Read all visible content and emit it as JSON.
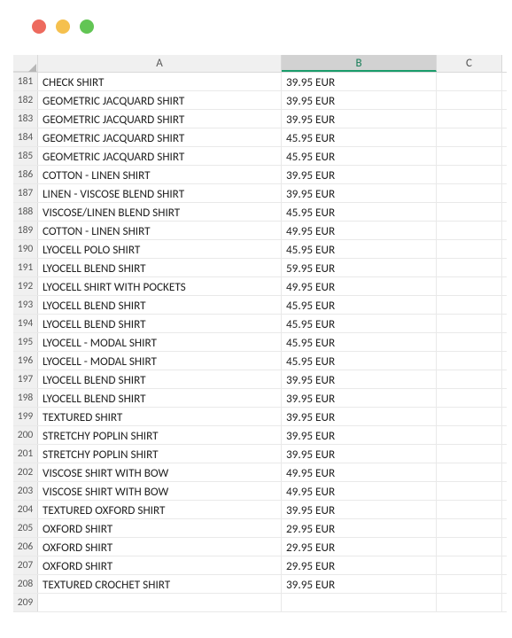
{
  "window": {
    "controls": [
      "close",
      "minimize",
      "maximize"
    ]
  },
  "spreadsheet": {
    "columns": [
      {
        "label": "A",
        "selected": false
      },
      {
        "label": "B",
        "selected": true
      },
      {
        "label": "C",
        "selected": false
      }
    ],
    "first_row_number": 181,
    "rows": [
      {
        "n": 181,
        "a": "CHECK SHIRT",
        "b": "39.95 EUR"
      },
      {
        "n": 182,
        "a": "GEOMETRIC JACQUARD SHIRT",
        "b": "39.95 EUR"
      },
      {
        "n": 183,
        "a": "GEOMETRIC JACQUARD SHIRT",
        "b": "39.95 EUR"
      },
      {
        "n": 184,
        "a": "GEOMETRIC JACQUARD SHIRT",
        "b": "45.95 EUR"
      },
      {
        "n": 185,
        "a": "GEOMETRIC JACQUARD SHIRT",
        "b": "45.95 EUR"
      },
      {
        "n": 186,
        "a": "COTTON - LINEN SHIRT",
        "b": "39.95 EUR"
      },
      {
        "n": 187,
        "a": "LINEN - VISCOSE BLEND SHIRT",
        "b": "39.95 EUR"
      },
      {
        "n": 188,
        "a": "VISCOSE/LINEN BLEND SHIRT",
        "b": "45.95 EUR"
      },
      {
        "n": 189,
        "a": "COTTON - LINEN SHIRT",
        "b": "49.95 EUR"
      },
      {
        "n": 190,
        "a": "LYOCELL POLO SHIRT",
        "b": "45.95 EUR"
      },
      {
        "n": 191,
        "a": "LYOCELL BLEND SHIRT",
        "b": "59.95 EUR"
      },
      {
        "n": 192,
        "a": "LYOCELL SHIRT WITH POCKETS",
        "b": "49.95 EUR"
      },
      {
        "n": 193,
        "a": "LYOCELL BLEND SHIRT",
        "b": "45.95 EUR"
      },
      {
        "n": 194,
        "a": "LYOCELL BLEND SHIRT",
        "b": "45.95 EUR"
      },
      {
        "n": 195,
        "a": "LYOCELL - MODAL SHIRT",
        "b": "45.95 EUR"
      },
      {
        "n": 196,
        "a": "LYOCELL - MODAL SHIRT",
        "b": "45.95 EUR"
      },
      {
        "n": 197,
        "a": "LYOCELL BLEND SHIRT",
        "b": "39.95 EUR"
      },
      {
        "n": 198,
        "a": "LYOCELL BLEND SHIRT",
        "b": "39.95 EUR"
      },
      {
        "n": 199,
        "a": "TEXTURED SHIRT",
        "b": "39.95 EUR"
      },
      {
        "n": 200,
        "a": "STRETCHY POPLIN SHIRT",
        "b": "39.95 EUR"
      },
      {
        "n": 201,
        "a": "STRETCHY POPLIN SHIRT",
        "b": "39.95 EUR"
      },
      {
        "n": 202,
        "a": "VISCOSE SHIRT WITH BOW",
        "b": "49.95 EUR"
      },
      {
        "n": 203,
        "a": "VISCOSE SHIRT WITH BOW",
        "b": "49.95 EUR"
      },
      {
        "n": 204,
        "a": "TEXTURED OXFORD SHIRT",
        "b": "39.95 EUR"
      },
      {
        "n": 205,
        "a": "OXFORD SHIRT",
        "b": "29.95 EUR"
      },
      {
        "n": 206,
        "a": "OXFORD SHIRT",
        "b": "29.95 EUR"
      },
      {
        "n": 207,
        "a": "OXFORD SHIRT",
        "b": "29.95 EUR"
      },
      {
        "n": 208,
        "a": "TEXTURED CROCHET SHIRT",
        "b": "39.95 EUR"
      },
      {
        "n": 209,
        "a": "",
        "b": ""
      }
    ]
  }
}
